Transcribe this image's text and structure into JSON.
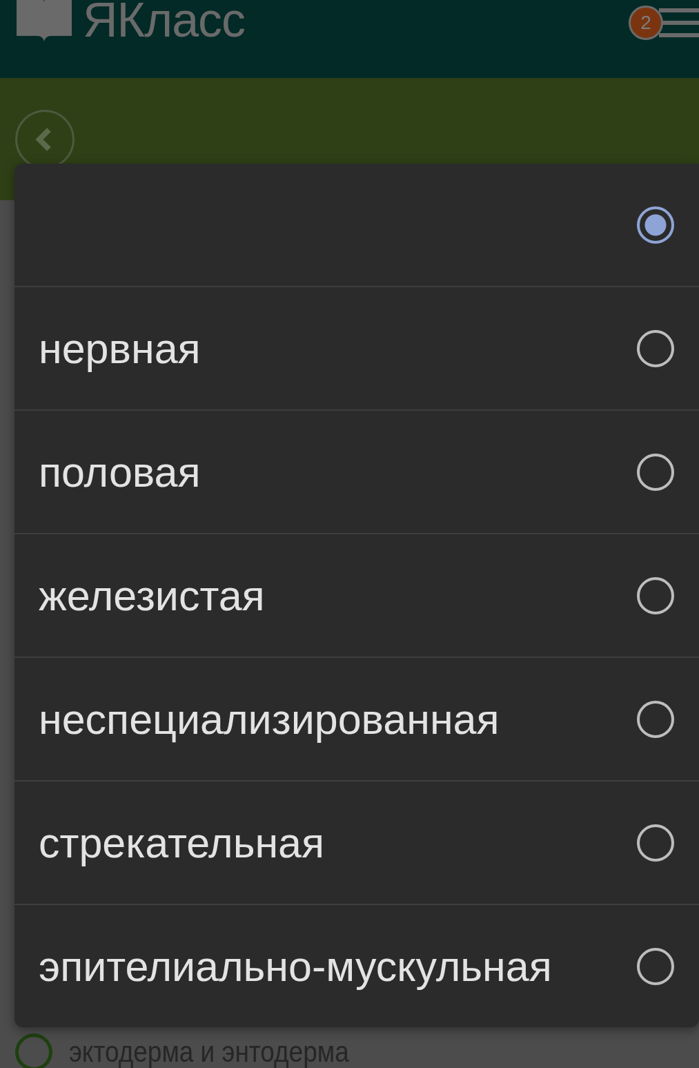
{
  "header": {
    "logo": "ЯКласс",
    "badge": "2"
  },
  "background_option": {
    "label": "эктодерма и энтодерма",
    "selected": false
  },
  "dialog": {
    "options": [
      {
        "selected": true
      },
      {
        "label": "нервная",
        "selected": false
      },
      {
        "label": "половая",
        "selected": false
      },
      {
        "label": "железистая",
        "selected": false
      },
      {
        "label": "неспециализированная",
        "selected": false
      },
      {
        "label": "стрекательная",
        "selected": false
      },
      {
        "label": "эпителиально-мускульная",
        "selected": false
      }
    ]
  }
}
